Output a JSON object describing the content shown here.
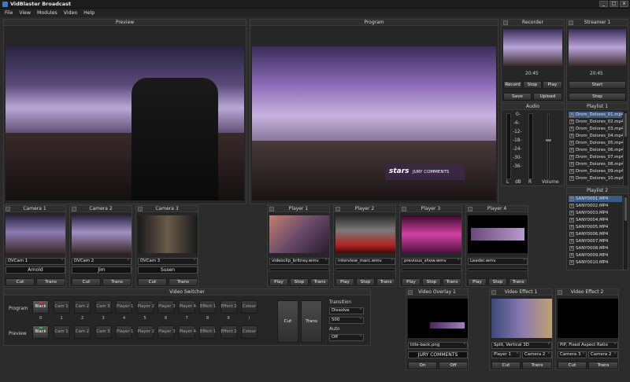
{
  "app": {
    "title": "VidBlaster Broadcast"
  },
  "window_controls": {
    "minimize": "_",
    "maximize": "□",
    "close": "x"
  },
  "menu": [
    "File",
    "View",
    "Modules",
    "Video",
    "Help"
  ],
  "preview": {
    "title": "Preview"
  },
  "program": {
    "title": "Program",
    "overlay_title": "stars",
    "overlay_text": "JURY COMMENTS"
  },
  "recorder": {
    "title": "Recorder",
    "time": "20:45",
    "buttons": {
      "record": "Record",
      "stop": "Stop",
      "play": "Play",
      "save": "Save",
      "upload": "Upload"
    }
  },
  "streamer": {
    "title": "Streamer 1",
    "time": "20:45",
    "buttons": {
      "start": "Start",
      "stop": "Stop"
    }
  },
  "audio": {
    "title": "Audio",
    "scale": [
      "0-",
      "-6-",
      "-12-",
      "-18-",
      "-24-",
      "-30-",
      "-36-"
    ],
    "labels": {
      "left": "L",
      "db": "dB",
      "right": "R",
      "volume": "Volume"
    },
    "volume_level": 0.6
  },
  "playlist1": {
    "title": "Playlist 1",
    "items": [
      "Drom_Dolores_01.mp4",
      "Drom_Dolores_02.mp4",
      "Drom_Dolores_03.mp4",
      "Drom_Dolores_04.mp4",
      "Drom_Dolores_05.mp4",
      "Drom_Dolores_06.mp4",
      "Drom_Dolores_07.mp4",
      "Drom_Dolores_08.mp4",
      "Drom_Dolores_09.mp4",
      "Drom_Dolores_10.mp4"
    ],
    "selected": 0
  },
  "playlist2": {
    "title": "Playlist 2",
    "items": [
      "SANY0001.MP4",
      "SANY0002.MP4",
      "SANY0003.MP4",
      "SANY0004.MP4",
      "SANY0005.MP4",
      "SANY0006.MP4",
      "SANY0007.MP4",
      "SANY0008.MP4",
      "SANY0009.MP4",
      "SANY0010.MP4"
    ],
    "selected": 0
  },
  "cameras": [
    {
      "title": "Camera 1",
      "source": "DVCam 1",
      "name": "Arnold",
      "cut": "Cut",
      "trans": "Trans"
    },
    {
      "title": "Camera 2",
      "source": "DVCam 2",
      "name": "Jim",
      "cut": "Cut",
      "trans": "Trans"
    },
    {
      "title": "Camera 3",
      "source": "DVCam 3",
      "name": "Susen",
      "cut": "Cut",
      "trans": "Trans"
    }
  ],
  "players": [
    {
      "title": "Player 1",
      "file": "videoclip_britney.wmv",
      "progress": 0.0,
      "play": "Play",
      "stop": "Stop",
      "trans": "Trans"
    },
    {
      "title": "Player 2",
      "file": "interview_marc.wmv",
      "progress": 0.0,
      "play": "Play",
      "stop": "Stop",
      "trans": "Trans"
    },
    {
      "title": "Player 3",
      "file": "previous_show.wmv",
      "progress": 0.0,
      "play": "Play",
      "stop": "Stop",
      "trans": "Trans"
    },
    {
      "title": "Player 4",
      "file": "Leader.wmv",
      "progress": 0.0,
      "play": "Play",
      "stop": "Stop",
      "trans": "Trans"
    }
  ],
  "switcher": {
    "title": "Video Switcher",
    "program_label": "Program",
    "preview_label": "Preview",
    "buttons": [
      "Black",
      "Cam 1",
      "Cam 2",
      "Cam 3",
      "Player 1",
      "Player 2",
      "Player 3",
      "Player 4",
      "Effect 1",
      "Effect 2",
      "Colour"
    ],
    "numbers": [
      "0",
      "1",
      "2",
      "3",
      "4",
      "5",
      "6",
      "7",
      "8",
      "9",
      "/"
    ],
    "program_active": 0,
    "preview_active": 0,
    "cut": "Cut",
    "trans": "Trans",
    "transition_label": "Transition",
    "transition_value": "Dissolve",
    "duration_value": "500",
    "auto_label": "Auto",
    "auto_value": "Off",
    "colors": {
      "program_led": "#e03030",
      "preview_led": "#30c040"
    }
  },
  "overlay1": {
    "title": "Video Overlay 1",
    "file": "title-back.png",
    "text": "JURY COMMENTS",
    "on": "On",
    "off": "Off"
  },
  "effect1": {
    "title": "Video Effect 1",
    "mode": "Split, Vertical 3D",
    "src_a": "Player 1",
    "src_b": "Camera 2",
    "cut": "Cut",
    "trans": "Trans"
  },
  "effect2": {
    "title": "Video Effect 2",
    "mode": "PiP, Fixed Aspect Ratio",
    "src_a": "Camera 3",
    "src_b": "Camera 2",
    "cut": "Cut",
    "trans": "Trans"
  }
}
